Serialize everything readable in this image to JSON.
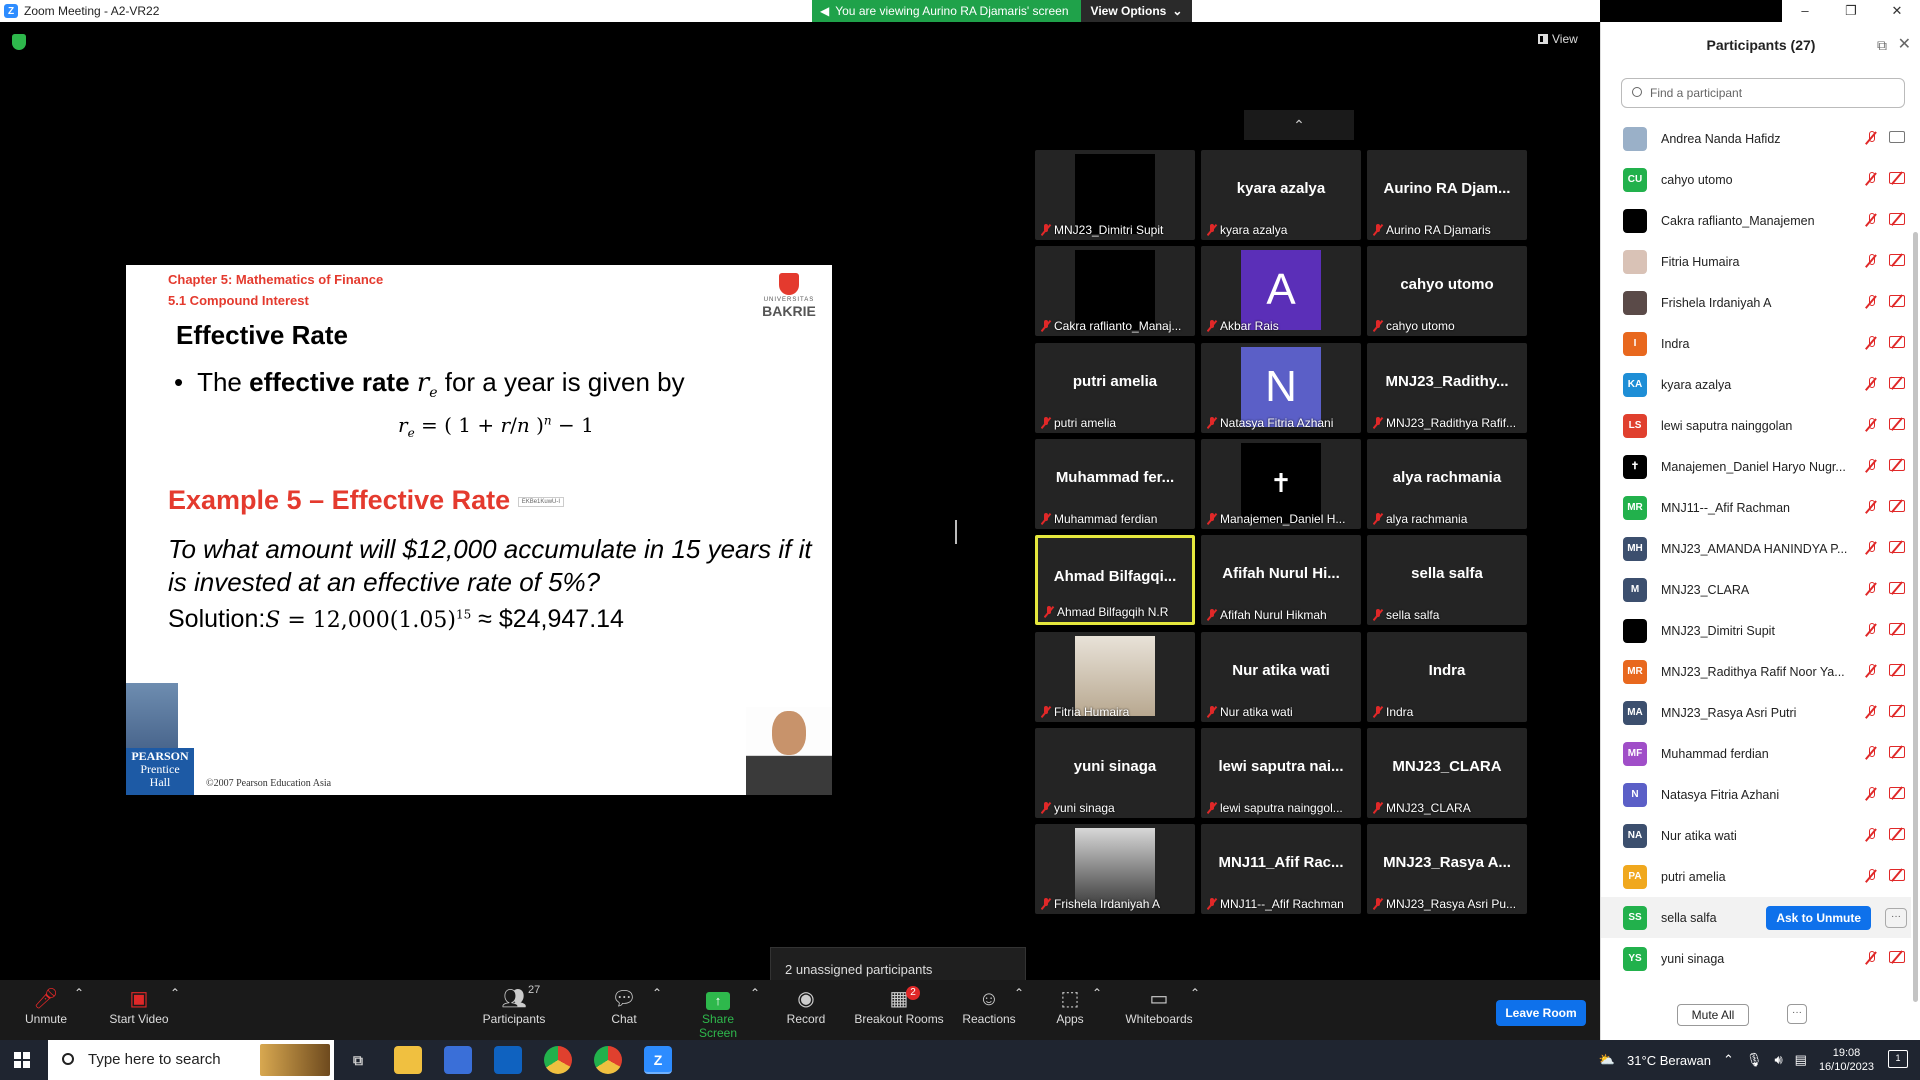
{
  "window": {
    "title": "Zoom Meeting - A2-VR22",
    "banner_msg": "You are viewing Aurino RA Djamaris' screen",
    "view_options": "View Options",
    "controls": [
      "–",
      "❐",
      "✕"
    ]
  },
  "view_button": "View",
  "slide": {
    "chapter": "Chapter 5: Mathematics of Finance",
    "section": "5.1 Compound Interest",
    "logo_lines": [
      "UNIVERSITAS",
      "BAKRIE"
    ],
    "heading": "Effective Rate",
    "bullet_pre": "The ",
    "bullet_bold": "effective rate",
    "bullet_post": " for a year is given by",
    "example": "Example 5 – Effective Rate",
    "example_tag": "EKBe1KuwU-I",
    "question": "To what amount will $12,000 accumulate in 15 years if it is invested at an effective rate of 5%?",
    "solution_label": "Solution:",
    "solution_result": "≈ $24,947.14",
    "publisher_1": "PEARSON",
    "publisher_2": "Prentice",
    "publisher_3": "Hall",
    "copyright": "©2007 Pearson Education Asia"
  },
  "gallery": {
    "tiles": [
      {
        "big": "",
        "cap": "MNJ23_Dimitri Supit",
        "thumb": "black"
      },
      {
        "big": "kyara azalya",
        "cap": "kyara azalya"
      },
      {
        "big": "Aurino RA Djam...",
        "cap": "Aurino RA Djamaris"
      },
      {
        "big": "",
        "cap": "Cakra raflianto_Manaj...",
        "thumb": "black"
      },
      {
        "big": "",
        "cap": "Akbar Rais",
        "thumb": "letter-A"
      },
      {
        "big": "cahyo utomo",
        "cap": "cahyo utomo"
      },
      {
        "big": "putri amelia",
        "cap": "putri amelia"
      },
      {
        "big": "",
        "cap": "Natasya Fitria Azhani",
        "thumb": "letter-N"
      },
      {
        "big": "MNJ23_Radithy...",
        "cap": "MNJ23_Radithya Rafif..."
      },
      {
        "big": "Muhammad fer...",
        "cap": "Muhammad ferdian"
      },
      {
        "big": "",
        "cap": "Manajemen_Daniel H...",
        "thumb": "cross"
      },
      {
        "big": "alya rachmania",
        "cap": "alya rachmania"
      },
      {
        "big": "Ahmad Bilfagqi...",
        "cap": "Ahmad Bilfagqih N.R",
        "active": true
      },
      {
        "big": "Afifah Nurul Hi...",
        "cap": "Afifah Nurul Hikmah"
      },
      {
        "big": "sella salfa",
        "cap": "sella salfa"
      },
      {
        "big": "",
        "cap": "Fitria Humaira",
        "thumb": "photo-light"
      },
      {
        "big": "Nur atika wati",
        "cap": "Nur atika wati"
      },
      {
        "big": "Indra",
        "cap": "Indra"
      },
      {
        "big": "yuni sinaga",
        "cap": "yuni sinaga"
      },
      {
        "big": "lewi saputra nai...",
        "cap": "lewi saputra nainggol..."
      },
      {
        "big": "MNJ23_CLARA",
        "cap": "MNJ23_CLARA"
      },
      {
        "big": "",
        "cap": "Frishela Irdaniyah A",
        "thumb": "photo-dark"
      },
      {
        "big": "MNJ11_Afif Rac...",
        "cap": "MNJ11--_Afif Rachman"
      },
      {
        "big": "MNJ23_Rasya A...",
        "cap": "MNJ23_Rasya Asri Pu..."
      }
    ],
    "thumb_letters": {
      "letter-A": "A",
      "letter-N": "N",
      "cross": "✝"
    },
    "thumb_colors": {
      "letter-A": "#5b2fb8",
      "letter-N": "#5b5fc7"
    }
  },
  "tooltip": "2 unassigned participants",
  "toolbar": {
    "unmute": "Unmute",
    "start_video": "Start Video",
    "participants": "Participants",
    "participants_count": "27",
    "chat": "Chat",
    "share_screen": "Share Screen",
    "record": "Record",
    "breakout": "Breakout Rooms",
    "breakout_badge": "2",
    "reactions": "Reactions",
    "apps": "Apps",
    "whiteboards": "Whiteboards",
    "leave": "Leave Room"
  },
  "panel": {
    "title": "Participants (27)",
    "search_placeholder": "Find a participant",
    "participants": [
      {
        "name": "Andrea Nanda Hafidz",
        "initials": "",
        "color": "#9ab0c8",
        "cam_on": true
      },
      {
        "name": "cahyo utomo",
        "initials": "CU",
        "color": "#22b14c"
      },
      {
        "name": "Cakra raflianto_Manajemen",
        "initials": "",
        "color": "#000000"
      },
      {
        "name": "Fitria Humaira",
        "initials": "",
        "color": "#d9c2b6"
      },
      {
        "name": "Frishela Irdaniyah A",
        "initials": "",
        "color": "#5a4a48"
      },
      {
        "name": "Indra",
        "initials": "I",
        "color": "#e8681e"
      },
      {
        "name": "kyara azalya",
        "initials": "KA",
        "color": "#1e8ed6"
      },
      {
        "name": "lewi saputra nainggolan",
        "initials": "LS",
        "color": "#e0402e"
      },
      {
        "name": "Manajemen_Daniel Haryo Nugr...",
        "initials": "✝",
        "color": "#000000"
      },
      {
        "name": "MNJ11--_Afif Rachman",
        "initials": "MR",
        "color": "#22b14c"
      },
      {
        "name": "MNJ23_AMANDA HANINDYA P...",
        "initials": "MH",
        "color": "#3c4f6e"
      },
      {
        "name": "MNJ23_CLARA",
        "initials": "M",
        "color": "#3c4f6e"
      },
      {
        "name": "MNJ23_Dimitri Supit",
        "initials": "",
        "color": "#000000"
      },
      {
        "name": "MNJ23_Radithya Rafif Noor Ya...",
        "initials": "MR",
        "color": "#e8681e"
      },
      {
        "name": "MNJ23_Rasya Asri Putri",
        "initials": "MA",
        "color": "#3c4f6e"
      },
      {
        "name": "Muhammad ferdian",
        "initials": "MF",
        "color": "#a04ec8"
      },
      {
        "name": "Natasya Fitria Azhani",
        "initials": "N",
        "color": "#5b5fc7"
      },
      {
        "name": "Nur atika wati",
        "initials": "NA",
        "color": "#3c4f6e"
      },
      {
        "name": "putri amelia",
        "initials": "PA",
        "color": "#f0a81e"
      },
      {
        "name": "sella salfa",
        "initials": "SS",
        "color": "#22b14c",
        "hover": true
      },
      {
        "name": "yuni sinaga",
        "initials": "YS",
        "color": "#22b14c"
      }
    ],
    "ask_unmute": "Ask to Unmute",
    "more": "···",
    "mute_all": "Mute All"
  },
  "taskbar": {
    "search_placeholder": "Type here to search",
    "weather": "31°C  Berawan",
    "time": "19:08",
    "date": "16/10/2023",
    "notif_count": "1"
  }
}
